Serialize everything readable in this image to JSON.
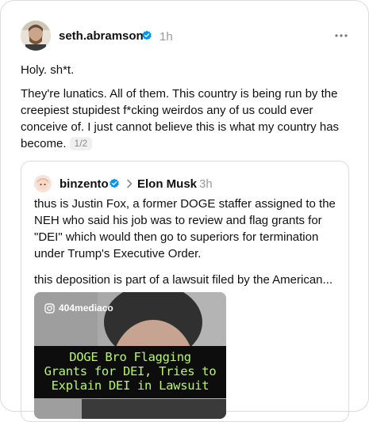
{
  "post": {
    "author": "seth.abramson",
    "time": "1h",
    "paragraph1": "Holy. sh*t.",
    "paragraph2": "They're lunatics. All of them. This country is being run by the creepiest stupidest f*cking weirdos any of us could ever conceive of. I just cannot believe this is what my country has become.",
    "page_indicator": "1/2"
  },
  "quoted": {
    "author": "binzento",
    "reply_to": "Elon Musk",
    "time": "3h",
    "paragraph1": "thus is Justin Fox, a former DOGE staffer assigned to the NEH who said his job was to review and flag grants for \"DEI\" which would then go to superiors for termination under Trump's Executive Order.",
    "paragraph2": "this deposition is part of a lawsuit filed by the American...",
    "media": {
      "brand": "404mediaco",
      "headline_line1": "DOGE Bro Flagging",
      "headline_line2": "Grants for DEI, Tries to",
      "headline_line3": "Explain DEI in Lawsuit"
    }
  },
  "colors": {
    "verified_blue": "#0095f6",
    "headline_green": "#b8f56b"
  },
  "icons": {
    "verified": "verified-badge-icon",
    "more": "more-horizontal-icon",
    "chevron": "chevron-right-icon",
    "instagram": "instagram-icon"
  }
}
